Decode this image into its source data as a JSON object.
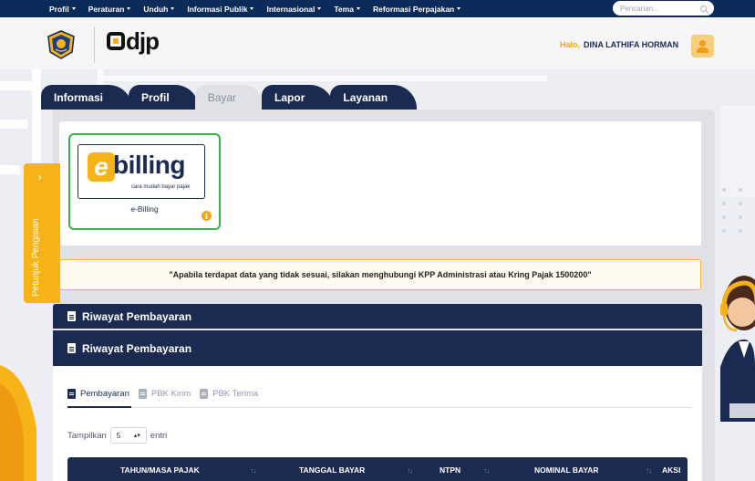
{
  "topnav": {
    "menu": [
      {
        "label": "Profil"
      },
      {
        "label": "Peraturan"
      },
      {
        "label": "Unduh"
      },
      {
        "label": "Informasi Publik"
      },
      {
        "label": "Internasional"
      },
      {
        "label": "Tema"
      },
      {
        "label": "Reformasi Perpajakan"
      }
    ],
    "search_placeholder": "Pencarian..."
  },
  "header": {
    "logo_text": "djp",
    "greeting": "Halo,",
    "username": "DINA LATHIFA HORMAN"
  },
  "tabs": [
    {
      "label": "Informasi",
      "active": false
    },
    {
      "label": "Profil",
      "active": false
    },
    {
      "label": "Bayar",
      "active": true
    },
    {
      "label": "Lapor",
      "active": false
    },
    {
      "label": "Layanan",
      "active": false
    }
  ],
  "side_tab": {
    "label": "Petunjuk Pengisian"
  },
  "apps": {
    "ebilling_logo_word": "billing",
    "ebilling_logo_e": "e",
    "ebilling_tagline": "cara mudah bayar pajak",
    "name": "e-Billing"
  },
  "notice": "\"Apabila terdapat data yang tidak sesuai, silakan menghubungi KPP Administrasi atau Kring Pajak 1500200\"",
  "section_titles": [
    "Riwayat Pembayaran",
    "Riwayat Pembayaran"
  ],
  "subtabs": [
    {
      "label": "Pembayaran",
      "active": true
    },
    {
      "label": "PBK Kirim",
      "active": false
    },
    {
      "label": "PBK Terima",
      "active": false
    }
  ],
  "table_length": {
    "prefix": "Tampilkan",
    "value": "5",
    "suffix": "entri"
  },
  "table": {
    "columns": [
      "TAHUN/MASA PAJAK",
      "TANGGAL BAYAR",
      "NTPN",
      "NOMINAL BAYAR",
      "AKSI"
    ]
  },
  "colors": {
    "navy": "#1b2a50",
    "accent": "#f6b318",
    "success": "#3db04b"
  }
}
